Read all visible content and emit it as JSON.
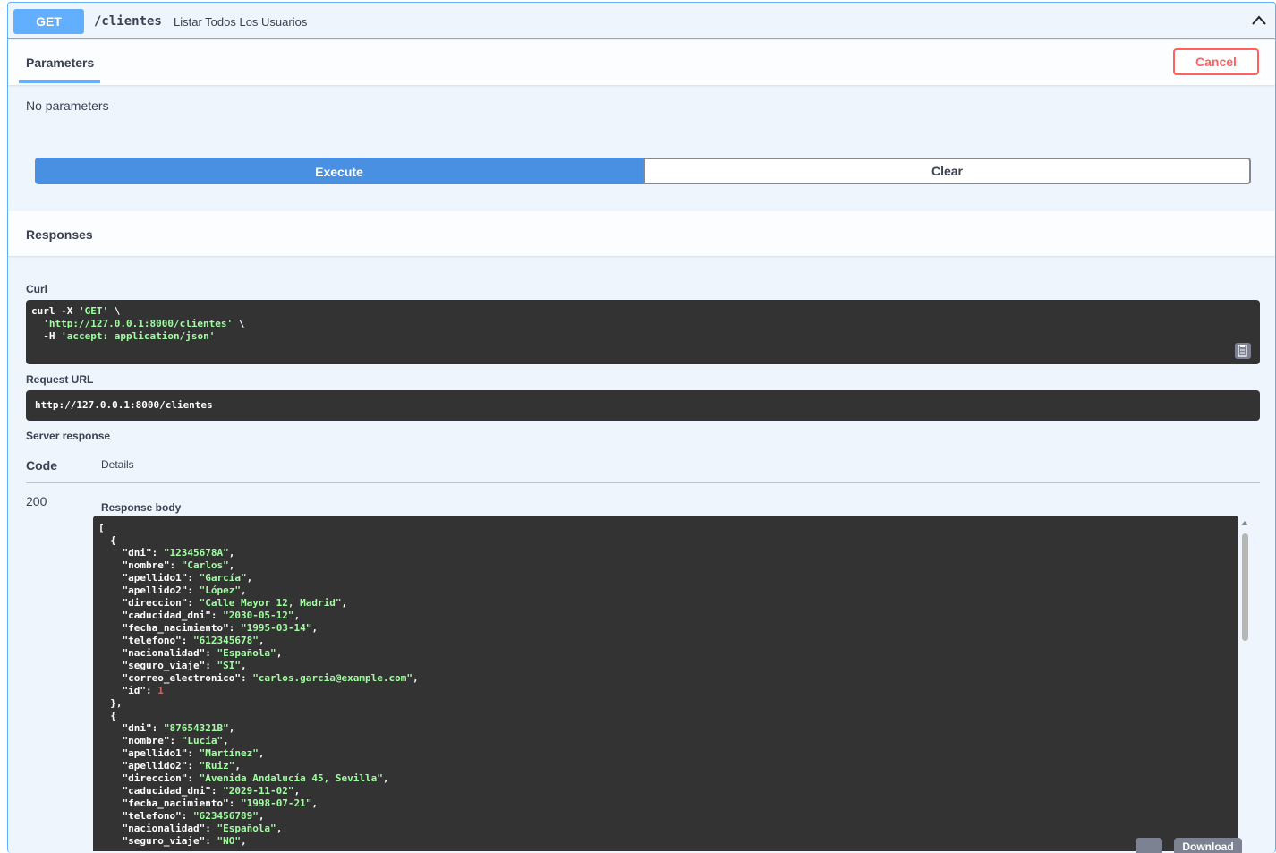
{
  "summary": {
    "method": "GET",
    "path": "/clientes",
    "description": "Listar Todos Los Usuarios",
    "collapse_icon": "chevron-up-icon"
  },
  "parameters": {
    "tab_label": "Parameters",
    "cancel_label": "Cancel",
    "empty_text": "No parameters"
  },
  "actions": {
    "execute_label": "Execute",
    "clear_label": "Clear"
  },
  "responses": {
    "title": "Responses",
    "curl_label": "Curl",
    "curl_lines": {
      "l1_cmd": "curl -X ",
      "l1_str": "'GET'",
      "l1_end": " \\",
      "l2_str": "'http://127.0.0.1:8000/clientes'",
      "l2_end": " \\",
      "l3_cmd": "  -H ",
      "l3_str": "'accept: application/json'"
    },
    "request_url_label": "Request URL",
    "request_url": "http://127.0.0.1:8000/clientes",
    "server_response_label": "Server response",
    "code_header": "Code",
    "details_header": "Details",
    "status_code": "200",
    "response_body_label": "Response body",
    "download_label": "Download",
    "body": [
      {
        "dni": "12345678A",
        "nombre": "Carlos",
        "apellido1": "García",
        "apellido2": "López",
        "direccion": "Calle Mayor 12, Madrid",
        "caducidad_dni": "2030-05-12",
        "fecha_nacimiento": "1995-03-14",
        "telefono": "612345678",
        "nacionalidad": "Española",
        "seguro_viaje": "SI",
        "correo_electronico": "carlos.garcia@example.com",
        "id": 1
      },
      {
        "dni": "87654321B",
        "nombre": "Lucía",
        "apellido1": "Martínez",
        "apellido2": "Ruiz",
        "direccion": "Avenida Andalucía 45, Sevilla",
        "caducidad_dni": "2029-11-02",
        "fecha_nacimiento": "1998-07-21",
        "telefono": "623456789",
        "nacionalidad": "Española",
        "seguro_viaje": "NO"
      }
    ]
  },
  "colors": {
    "get_accent": "#61affe",
    "execute_bg": "#4990e2",
    "cancel_red": "#ff6060",
    "code_bg": "#333333",
    "string_green": "#a2fca2",
    "number_red": "#d36363"
  }
}
